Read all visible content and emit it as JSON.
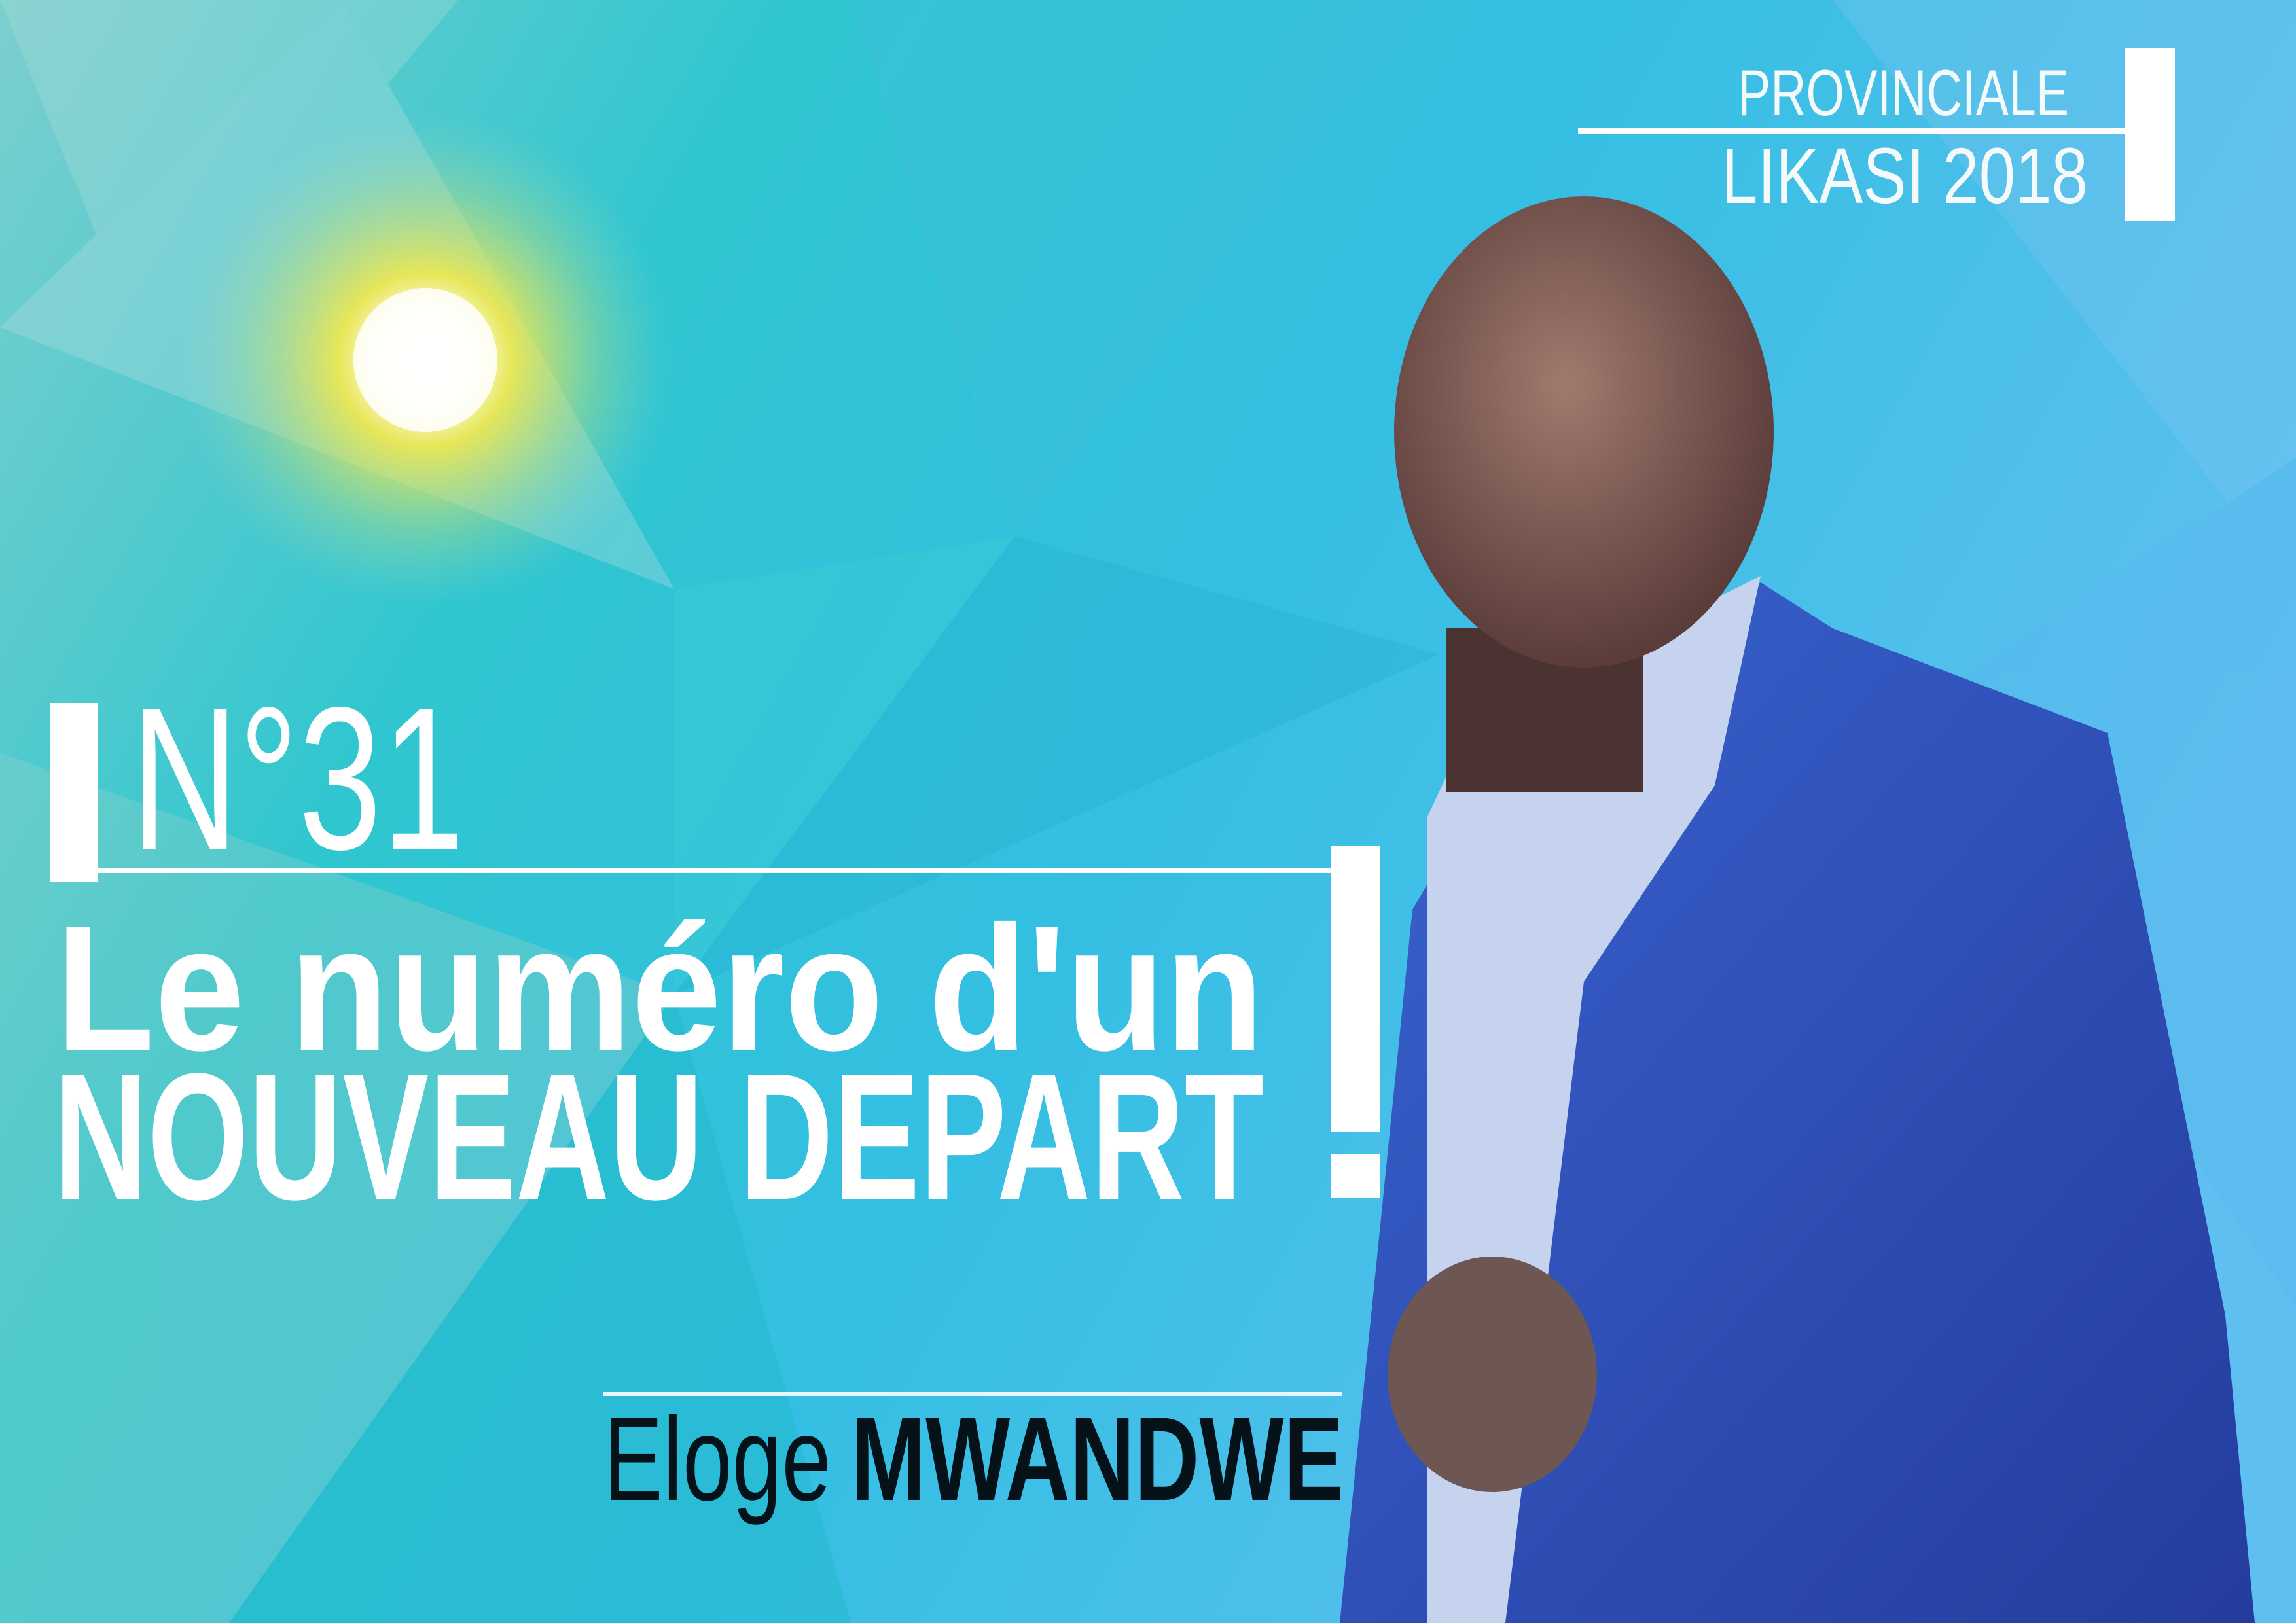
{
  "header": {
    "election_label": "PROVINCIALE",
    "location_year": "LIKASI 2018"
  },
  "candidate": {
    "number": "N°31",
    "slogan_line1": "Le numéro d'un",
    "slogan_line2": "NOUVEAU DEPART",
    "first_name": "Eloge",
    "last_name": "MWANDWE"
  },
  "colors": {
    "background_teal": "#2ec9c9",
    "background_blue": "#3bb8e6",
    "text_white": "#ffffff",
    "name_dark": "#06121a",
    "suit_blue": "#2f4fc0",
    "sun_yellow": "#f2e23a"
  },
  "icons": {
    "sun": "sun-flare-icon"
  }
}
